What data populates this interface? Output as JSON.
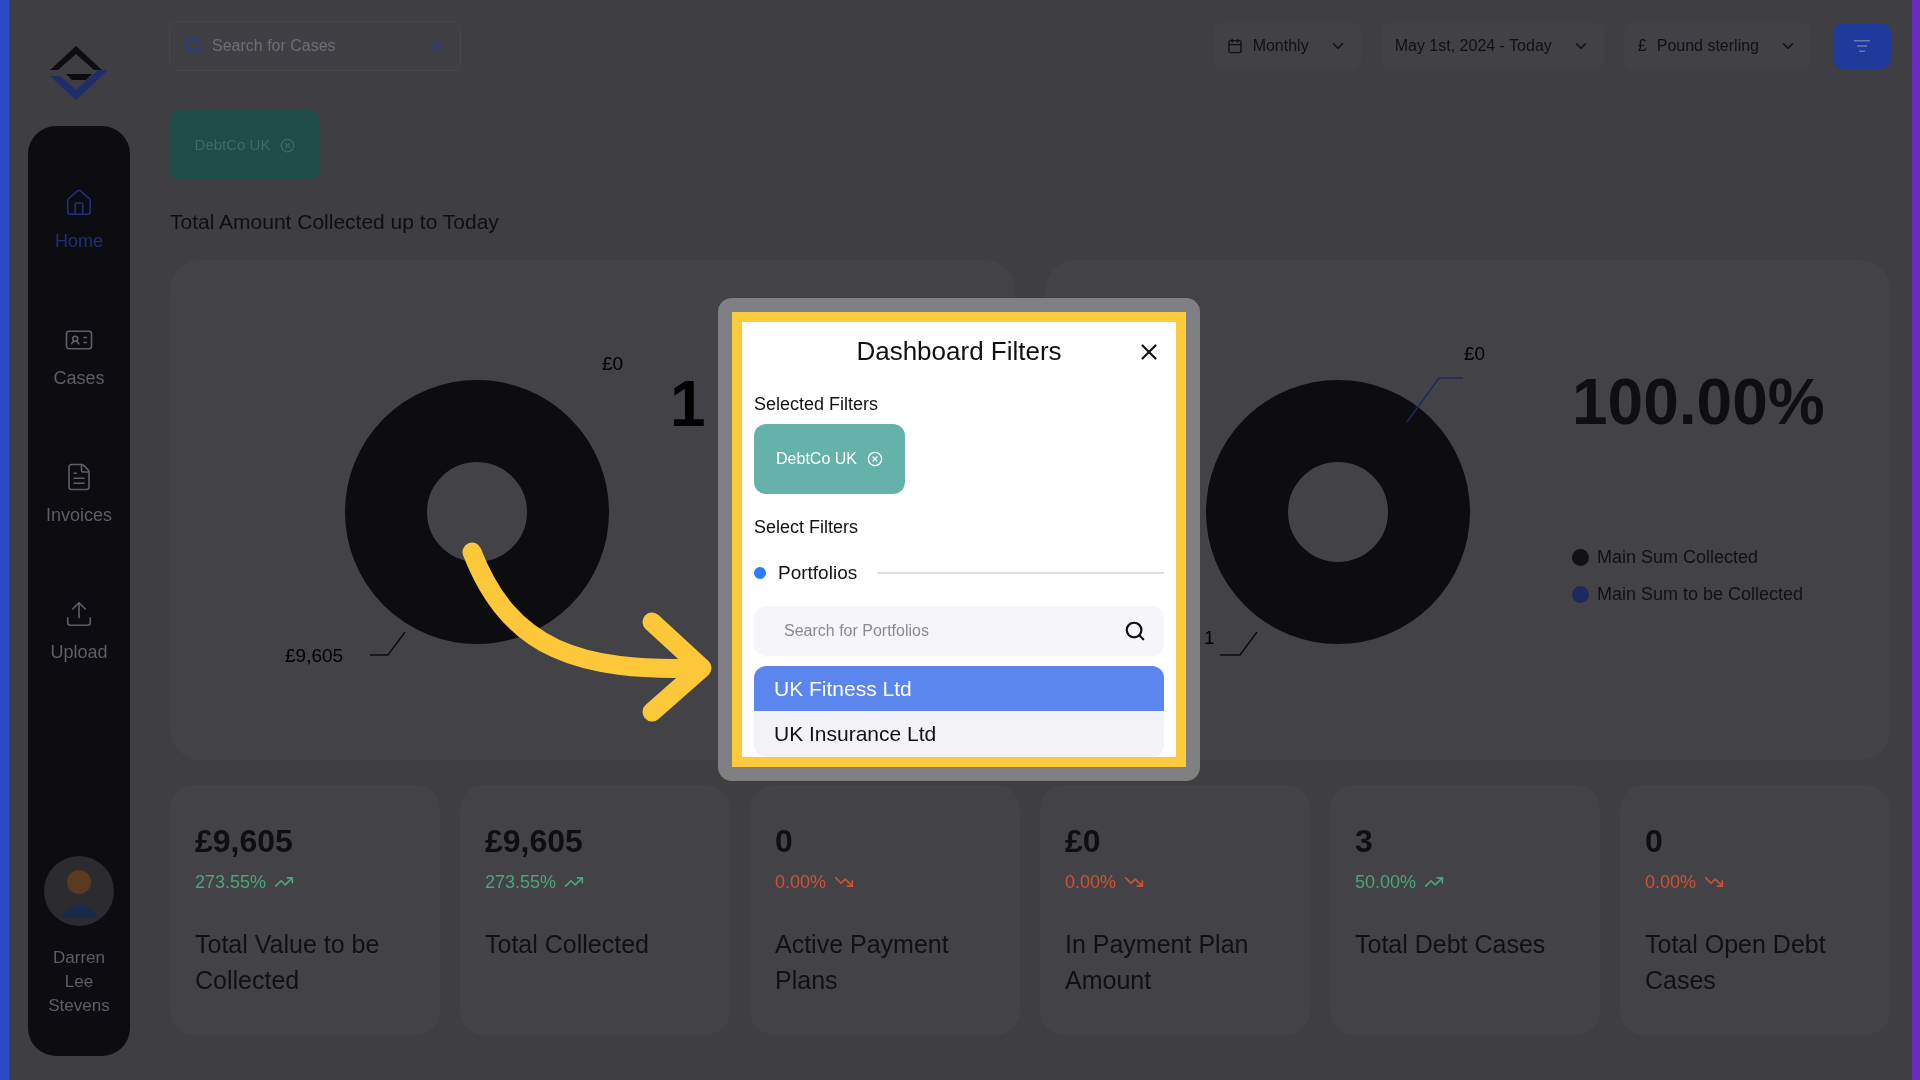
{
  "search": {
    "placeholder": "Search for Cases"
  },
  "toolbar": {
    "period": "Monthly",
    "date_range": "May 1st, 2024 - Today",
    "currency_symbol": "£",
    "currency": "Pound sterling"
  },
  "sidebar": {
    "items": [
      {
        "label": "Home",
        "kind": "home",
        "selected": true
      },
      {
        "label": "Cases",
        "kind": "cases",
        "selected": false
      },
      {
        "label": "Invoices",
        "kind": "invoices",
        "selected": false
      },
      {
        "label": "Upload",
        "kind": "upload",
        "selected": false
      }
    ],
    "user": {
      "name": "Darren Lee Stevens"
    }
  },
  "active_filters": [
    {
      "label": "DebtCo UK"
    }
  ],
  "section_title": "Total Amount Collected up to Today",
  "charts": [
    {
      "headline": "1",
      "slice_labels": [
        "£0",
        "£9,605"
      ]
    },
    {
      "headline": "100.00%",
      "slice_labels": [
        "£0",
        "1"
      ],
      "legend": [
        {
          "label": "Main Sum Collected",
          "color": "#121115"
        },
        {
          "label": "Main Sum to be Collected",
          "color": "#1f2a5c"
        }
      ]
    }
  ],
  "stats": [
    {
      "value": "£9,605",
      "change": "273.55%",
      "rising": true,
      "label": "Total Value to be Collected"
    },
    {
      "value": "£9,605",
      "change": "273.55%",
      "rising": true,
      "label": "Total Collected"
    },
    {
      "value": "0",
      "change": "0.00%",
      "rising": false,
      "label": "Active Payment Plans"
    },
    {
      "value": "£0",
      "change": "0.00%",
      "rising": false,
      "label": "In Payment Plan Amount"
    },
    {
      "value": "3",
      "change": "50.00%",
      "rising": true,
      "label": "Total Debt Cases"
    },
    {
      "value": "0",
      "change": "0.00%",
      "rising": false,
      "label": "Total Open Debt Cases"
    }
  ],
  "modal": {
    "title": "Dashboard Filters",
    "selected_label": "Selected Filters",
    "selected_filters": [
      {
        "label": "DebtCo UK"
      }
    ],
    "select_label": "Select Filters",
    "group": "Portfolios",
    "search_placeholder": "Search for Portfolios",
    "options": [
      {
        "label": "UK Fitness Ltd",
        "selected": true
      },
      {
        "label": "UK Insurance Ltd",
        "selected": false
      }
    ]
  }
}
